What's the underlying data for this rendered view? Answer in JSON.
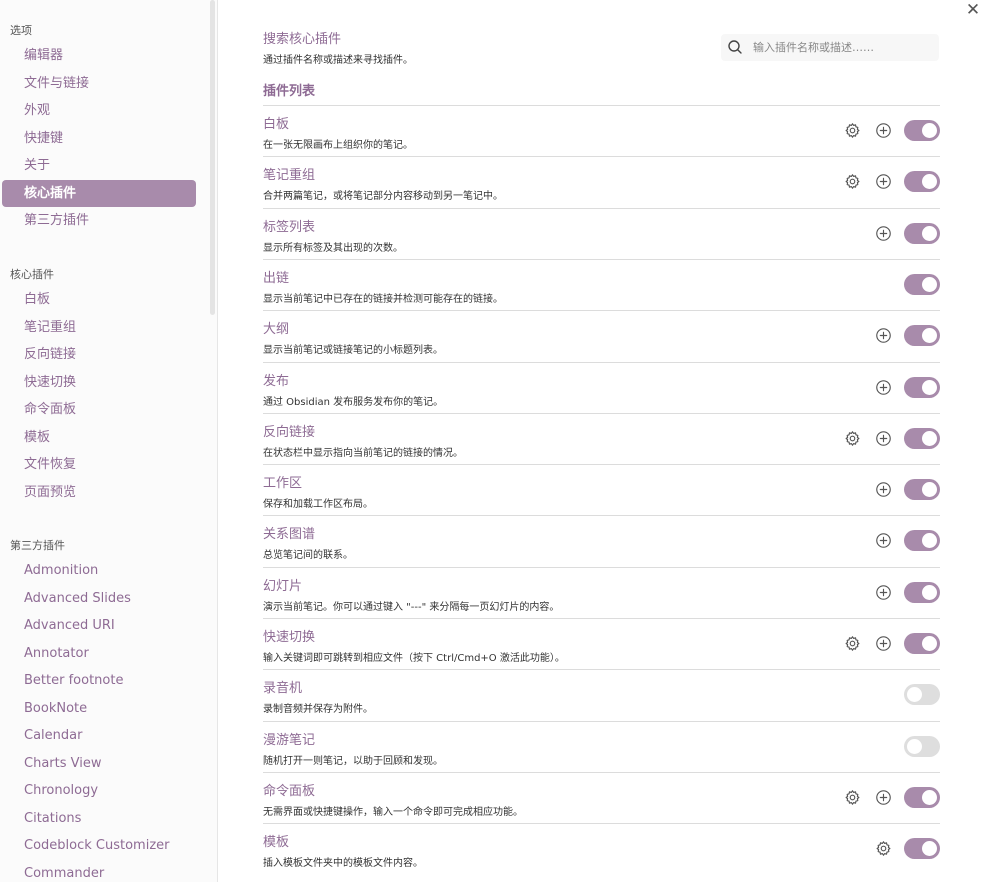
{
  "sidebar": {
    "options_header": "选项",
    "options": [
      "编辑器",
      "文件与链接",
      "外观",
      "快捷键",
      "关于",
      "核心插件",
      "第三方插件"
    ],
    "active": "核心插件",
    "core_header": "核心插件",
    "core_items": [
      "白板",
      "笔记重组",
      "反向链接",
      "快速切换",
      "命令面板",
      "模板",
      "文件恢复",
      "页面预览"
    ],
    "third_header": "第三方插件",
    "third_items": [
      "Admonition",
      "Advanced Slides",
      "Advanced URI",
      "Annotator",
      "Better footnote",
      "BookNote",
      "Calendar",
      "Charts View",
      "Chronology",
      "Citations",
      "Codeblock Customizer",
      "Commander"
    ]
  },
  "main": {
    "close_glyph": "✕",
    "search_title": "搜索核心插件",
    "search_desc": "通过插件名称或描述来寻找插件。",
    "search_placeholder": "输入插件名称或描述……",
    "list_heading": "插件列表",
    "plugins": [
      {
        "name": "白板",
        "desc": "在一张无限画布上组织你的笔记。",
        "gear": true,
        "plus": true,
        "enabled": true
      },
      {
        "name": "笔记重组",
        "desc": "合并两篇笔记，或将笔记部分内容移动到另一笔记中。",
        "gear": true,
        "plus": true,
        "enabled": true
      },
      {
        "name": "标签列表",
        "desc": "显示所有标签及其出现的次数。",
        "gear": false,
        "plus": true,
        "enabled": true
      },
      {
        "name": "出链",
        "desc": "显示当前笔记中已存在的链接并检测可能存在的链接。",
        "gear": false,
        "plus": false,
        "enabled": true
      },
      {
        "name": "大纲",
        "desc": "显示当前笔记或链接笔记的小标题列表。",
        "gear": false,
        "plus": true,
        "enabled": true
      },
      {
        "name": "发布",
        "desc": "通过 Obsidian 发布服务发布你的笔记。",
        "gear": false,
        "plus": true,
        "enabled": true
      },
      {
        "name": "反向链接",
        "desc": "在状态栏中显示指向当前笔记的链接的情况。",
        "gear": true,
        "plus": true,
        "enabled": true
      },
      {
        "name": "工作区",
        "desc": "保存和加载工作区布局。",
        "gear": false,
        "plus": true,
        "enabled": true
      },
      {
        "name": "关系图谱",
        "desc": "总览笔记间的联系。",
        "gear": false,
        "plus": true,
        "enabled": true
      },
      {
        "name": "幻灯片",
        "desc": "演示当前笔记。你可以通过键入 \"---\" 来分隔每一页幻灯片的内容。",
        "gear": false,
        "plus": true,
        "enabled": true
      },
      {
        "name": "快速切换",
        "desc": "输入关键词即可跳转到相应文件（按下 Ctrl/Cmd+O 激活此功能）。",
        "gear": true,
        "plus": true,
        "enabled": true
      },
      {
        "name": "录音机",
        "desc": "录制音频并保存为附件。",
        "gear": false,
        "plus": false,
        "enabled": false
      },
      {
        "name": "漫游笔记",
        "desc": "随机打开一则笔记，以助于回顾和发现。",
        "gear": false,
        "plus": false,
        "enabled": false
      },
      {
        "name": "命令面板",
        "desc": "无需界面或快捷键操作，输入一个命令即可完成相应功能。",
        "gear": true,
        "plus": true,
        "enabled": true
      },
      {
        "name": "模板",
        "desc": "插入模板文件夹中的模板文件内容。",
        "gear": true,
        "plus": false,
        "enabled": true
      }
    ]
  },
  "colors": {
    "accent": "#a88bab",
    "link": "#8e6b94"
  }
}
